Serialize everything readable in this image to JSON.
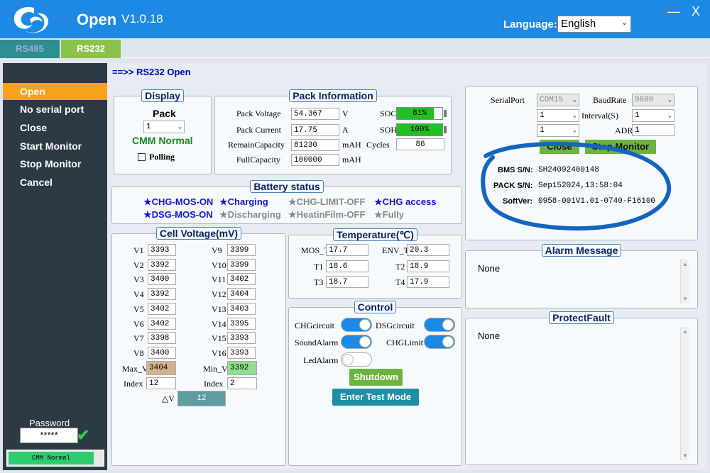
{
  "window": {
    "title": "Open",
    "version": "V1.0.18",
    "minimize": "—",
    "close": "X",
    "language_label": "Language:",
    "language_value": "English"
  },
  "tabs": [
    {
      "label": "RS485"
    },
    {
      "label": "RS232"
    }
  ],
  "sidebar": {
    "items": [
      {
        "label": "Open"
      },
      {
        "label": "No serial port"
      },
      {
        "label": "Close"
      },
      {
        "label": "Start Monitor"
      },
      {
        "label": "Stop Monitor"
      },
      {
        "label": "Cancel"
      }
    ],
    "password_label": "Password",
    "password_value": "*****",
    "status": "CMM Normal"
  },
  "status_line": "==>> RS232 Open",
  "display": {
    "title": "Display",
    "pack_label": "Pack",
    "pack_value": "1",
    "comm_status": "CMM Normal",
    "polling_label": "Polling"
  },
  "pack_info": {
    "title": "Pack Information",
    "pack_voltage_label": "Pack Voltage",
    "pack_voltage": "54.367",
    "pack_voltage_unit": "V",
    "pack_current_label": "Pack Current",
    "pack_current": "17.75",
    "pack_current_unit": "A",
    "remain_label": "RemainCapacity",
    "remain": "81230",
    "remain_unit": "mAH",
    "full_label": "FullCapacity",
    "full": "100000",
    "full_unit": "mAH",
    "soc_label": "SOC",
    "soc_text": "81%",
    "soc": 0.81,
    "soh_label": "SOH",
    "soh_text": "100%",
    "soh": 1.0,
    "cycles_label": "Cycles",
    "cycles": "86"
  },
  "battery_status": {
    "title": "Battery status",
    "items": [
      {
        "label": "★CHG-MOS-ON"
      },
      {
        "label": "★Charging"
      },
      {
        "label": "★CHG-LIMIT-OFF"
      },
      {
        "label": "★CHG access"
      },
      {
        "label": "★DSG-MOS-ON"
      },
      {
        "label": "★Discharging"
      },
      {
        "label": "★HeatinFilm-OFF"
      },
      {
        "label": "★Fully"
      }
    ]
  },
  "cell_voltage": {
    "title": "Cell Voltage(mV)",
    "left": [
      {
        "label": "V1",
        "value": "3393"
      },
      {
        "label": "V2",
        "value": "3392"
      },
      {
        "label": "V3",
        "value": "3400"
      },
      {
        "label": "V4",
        "value": "3392"
      },
      {
        "label": "V5",
        "value": "3402"
      },
      {
        "label": "V6",
        "value": "3402"
      },
      {
        "label": "V7",
        "value": "3398"
      },
      {
        "label": "V8",
        "value": "3400"
      }
    ],
    "right": [
      {
        "label": "V9",
        "value": "3399"
      },
      {
        "label": "V10",
        "value": "3399"
      },
      {
        "label": "V11",
        "value": "3402"
      },
      {
        "label": "V12",
        "value": "3404"
      },
      {
        "label": "V13",
        "value": "3403"
      },
      {
        "label": "V14",
        "value": "3395"
      },
      {
        "label": "V15",
        "value": "3393"
      },
      {
        "label": "V16",
        "value": "3393"
      }
    ],
    "max_label": "Max_V",
    "max_value": "3404",
    "min_label": "Min_V",
    "min_value": "3392",
    "max_index_label": "Index",
    "max_index": "12",
    "min_index_label": "Index",
    "min_index": "2",
    "delta_label": "△V",
    "delta_value": "12"
  },
  "temperature": {
    "title": "Temperature(℃)",
    "mos_label": "MOS_T",
    "mos": "17.7",
    "env_label": "ENV_T",
    "env": "20.3",
    "t1_label": "T1",
    "t1": "18.6",
    "t2_label": "T2",
    "t2": "18.9",
    "t3_label": "T3",
    "t3": "18.7",
    "t4_label": "T4",
    "t4": "17.9"
  },
  "control": {
    "title": "Control",
    "chg_circuit": "CHGcircuit",
    "dsg_circuit": "DSGcircuit",
    "sound_alarm": "SoundAlarm",
    "chg_limit": "CHGLimit",
    "led_alarm": "LedAlarm",
    "shutdown": "Shutdown",
    "test_mode": "Enter Test Mode"
  },
  "serial": {
    "port_label": "SerialPort",
    "port": "COM15",
    "baud_label": "BaudRate",
    "baud": "9600",
    "sel1": "1",
    "interval_label": "Interval(S)",
    "interval": "1",
    "sel2": "1",
    "adr_label": "ADR",
    "adr": "1",
    "close_btn": "Close",
    "stop_btn": "Stop Monitor",
    "bms_sn_label": "BMS S/N:",
    "bms_sn": "SH24092400148",
    "pack_sn_label": "PACK S/N:",
    "pack_sn": "Sep152024,13:58:04",
    "softver_label": "SoftVer:",
    "softver": "0958-001V1.01-0740-F16100"
  },
  "alarm": {
    "title": "Alarm Message",
    "text": "None"
  },
  "protect": {
    "title": "ProtectFault",
    "text": "None"
  },
  "colors": {
    "titlebar": "#1e88e5",
    "sidebar": "#2b3a43",
    "active": "#f7a21b",
    "ok_green": "#21c021",
    "annotation": "#1565c0"
  }
}
